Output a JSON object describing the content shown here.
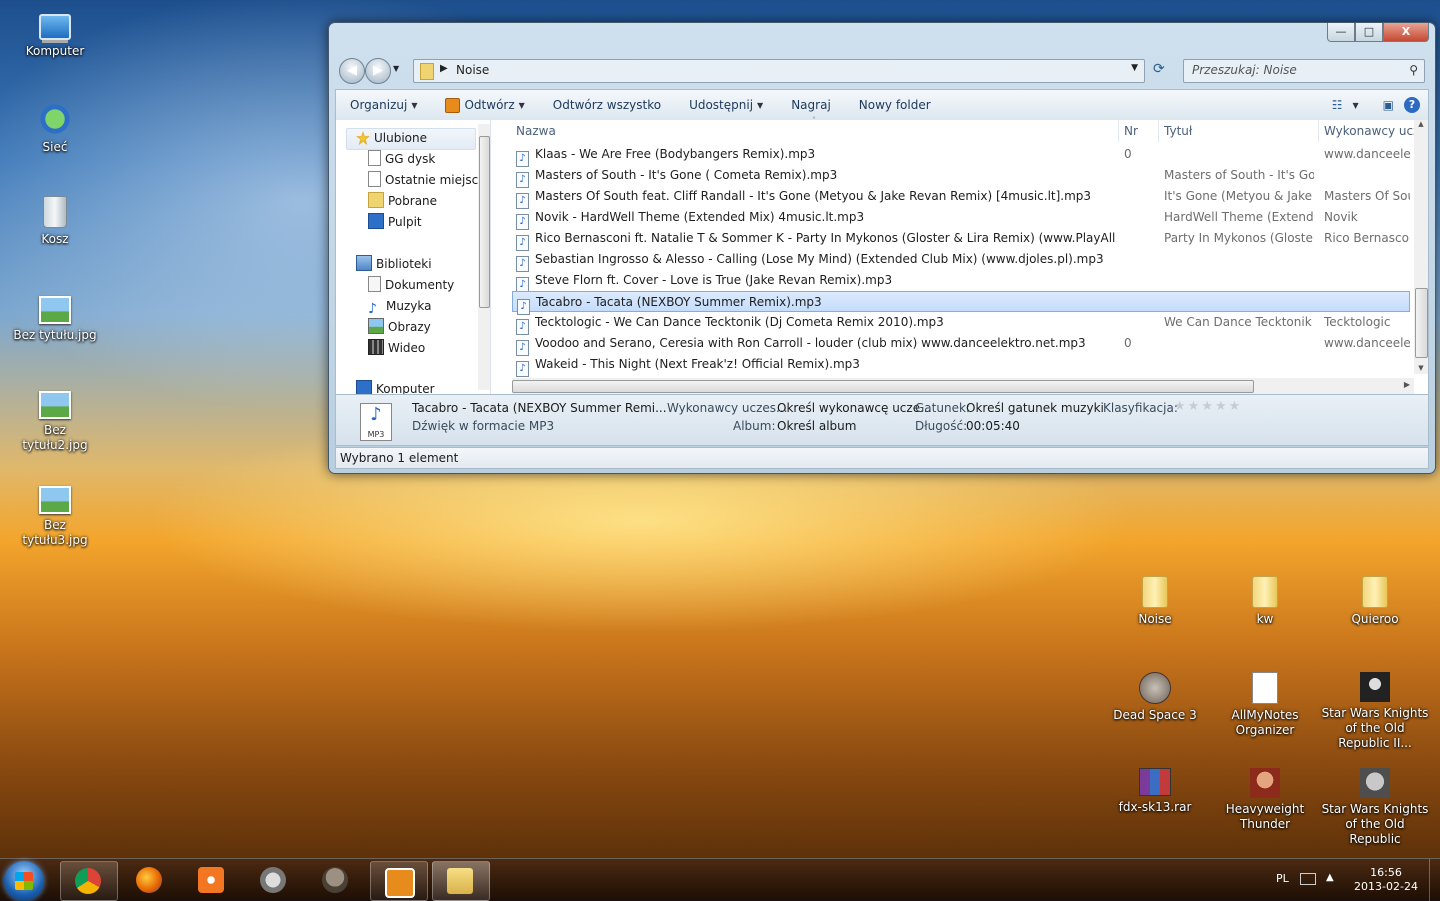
{
  "desktop": {
    "left_icons": [
      {
        "label": "Komputer",
        "icon": "computer-icon"
      },
      {
        "label": "Sieć",
        "icon": "network-icon"
      },
      {
        "label": "Kosz",
        "icon": "recycle-bin-icon"
      },
      {
        "label": "Bez tytułu.jpg",
        "icon": "image-file-icon"
      },
      {
        "label": "Bez tytułu2.jpg",
        "icon": "image-file-icon"
      },
      {
        "label": "Bez tytułu3.jpg",
        "icon": "image-file-icon"
      }
    ],
    "right_icons": [
      {
        "label": "Noise",
        "icon": "folder-icon"
      },
      {
        "label": "kw",
        "icon": "folder-icon"
      },
      {
        "label": "Quieroo",
        "icon": "folder-icon"
      },
      {
        "label": "Dead Space 3",
        "icon": "game-icon"
      },
      {
        "label": "AllMyNotes Organizer",
        "icon": "notes-app-icon"
      },
      {
        "label": "Star Wars Knights of the Old Republic II...",
        "icon": "game-icon"
      },
      {
        "label": "fdx-sk13.rar",
        "icon": "rar-archive-icon"
      },
      {
        "label": "Heavyweight Thunder",
        "icon": "game-icon"
      },
      {
        "label": "Star Wars Knights of the Old Republic",
        "icon": "game-icon"
      }
    ]
  },
  "window": {
    "address": {
      "path": "Noise"
    },
    "search": {
      "placeholder": "Przeszukaj: Noise"
    },
    "caption": {
      "minimize": "—",
      "maximize": "□",
      "close": "X"
    },
    "toolbar": {
      "organize": "Organizuj",
      "open": "Odtwórz",
      "play_all": "Odtwórz wszystko",
      "share": "Udostępnij",
      "burn": "Nagraj",
      "new_folder": "Nowy folder"
    },
    "nav_pane": {
      "favorites": "Ulubione",
      "favorites_items": [
        "GG dysk",
        "Ostatnie miejsca",
        "Pobrane",
        "Pulpit"
      ],
      "libraries": "Biblioteki",
      "libraries_items": [
        "Dokumenty",
        "Muzyka",
        "Obrazy",
        "Wideo"
      ],
      "computer": "Komputer"
    },
    "columns": {
      "name": "Nazwa",
      "nr": "Nr",
      "title": "Tytuł",
      "artists": "Wykonawcy ucze"
    },
    "files": [
      {
        "name": "Klaas - We Are Free (Bodybangers Remix).mp3",
        "nr": "0",
        "title": "",
        "artists": "www.danceelektr"
      },
      {
        "name": "Masters of South - It's Gone ( Cometa Remix).mp3",
        "nr": "",
        "title": "Masters of South - It's Go...",
        "artists": ""
      },
      {
        "name": "Masters Of South feat. Cliff Randall - It's Gone (Metyou & Jake Revan Remix) [4music.lt].mp3",
        "nr": "",
        "title": "It's Gone (Metyou & Jake ...",
        "artists": "Masters Of South"
      },
      {
        "name": "Novik - HardWell Theme (Extended Mix) 4music.lt.mp3",
        "nr": "",
        "title": "HardWell Theme (Extende...",
        "artists": "Novik"
      },
      {
        "name": "Rico Bernasconi ft. Natalie T & Sommer K - Party In Mykonos (Gloster & Lira Remix) (www.PlayAll.lt).mp3",
        "nr": "",
        "title": "Party In Mykonos (Gloster...",
        "artists": "Rico Bernasconi f"
      },
      {
        "name": "Sebastian Ingrosso & Alesso - Calling (Lose My Mind) (Extended Club Mix) (www.djoles.pl).mp3",
        "nr": "",
        "title": "",
        "artists": ""
      },
      {
        "name": "Steve Florn ft. Cover - Love is True (Jake Revan Remix).mp3",
        "nr": "",
        "title": "",
        "artists": ""
      },
      {
        "name": "Tacabro - Tacata (NEXBOY Summer Remix).mp3",
        "nr": "",
        "title": "",
        "artists": "",
        "selected": true
      },
      {
        "name": "Tecktologic - We Can Dance Tecktonik (Dj Cometa Remix 2010).mp3",
        "nr": "",
        "title": "We Can Dance Tecktonik ...",
        "artists": "Tecktologic"
      },
      {
        "name": "Voodoo and Serano, Ceresia with Ron Carroll - louder (club mix)  www.danceelektro.net.mp3",
        "nr": "0",
        "title": "",
        "artists": "www.danceelektr"
      },
      {
        "name": "Wakeid - This Night (Next Freak'z! Official Remix).mp3",
        "nr": "",
        "title": "",
        "artists": ""
      }
    ],
    "details": {
      "filename": "Tacabro - Tacata (NEXBOY Summer Remi...",
      "filetype": "Dźwięk w formacie MP3",
      "artists_key": "Wykonawcy uczes...",
      "artists_val": "Określ wykonawcę ucze...",
      "genre_key": "Gatunek:",
      "genre_val": "Określ gatunek muzyki",
      "rating_key": "Klasyfikacja:",
      "rating": 0,
      "album_key": "Album:",
      "album_val": "Określ album",
      "length_key": "Długość:",
      "length_val": "00:05:40",
      "icon_caption": "MP3"
    },
    "status": "Wybrano 1 element"
  },
  "taskbar": {
    "apps": [
      "start-orb",
      "chrome",
      "firefox",
      "xampp",
      "network-app",
      "gimp",
      "media-player",
      "explorer"
    ],
    "language": "PL",
    "time": "16:56",
    "date": "2013-02-24"
  }
}
